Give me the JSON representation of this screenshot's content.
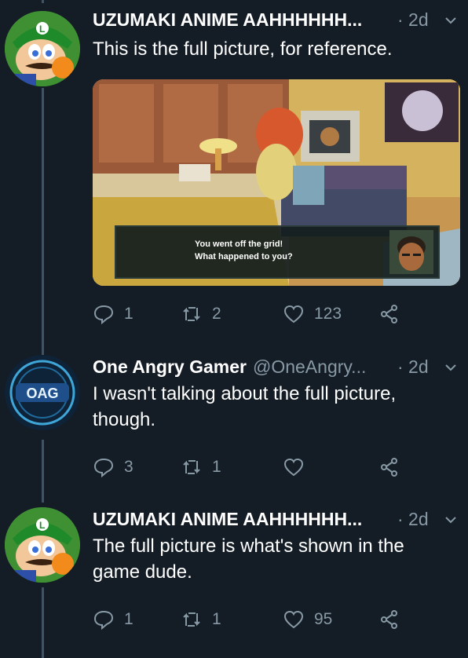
{
  "tweets": [
    {
      "name": "UZUMAKI ANIME AAHHHHHH...",
      "handle": "",
      "time": "· 2d",
      "text": "This is the full picture, for reference.",
      "media": {
        "dialog_line1": "You went off the grid!",
        "dialog_line2": "What happened to you?"
      },
      "replies": "1",
      "retweets": "2",
      "likes": "123"
    },
    {
      "name": "One Angry Gamer",
      "handle": "@OneAngry...",
      "time": "· 2d",
      "text": "I wasn't talking about the full picture, though.",
      "avatar_label": "OAG",
      "replies": "3",
      "retweets": "1",
      "likes": ""
    },
    {
      "name": "UZUMAKI ANIME AAHHHHHH...",
      "handle": "",
      "time": "· 2d",
      "text": "The full picture is what's shown in the game dude.",
      "replies": "1",
      "retweets": "1",
      "likes": "95"
    }
  ],
  "colors": {
    "background": "#141d26",
    "secondary_text": "#8899a6",
    "thread_line": "#3d5466"
  }
}
